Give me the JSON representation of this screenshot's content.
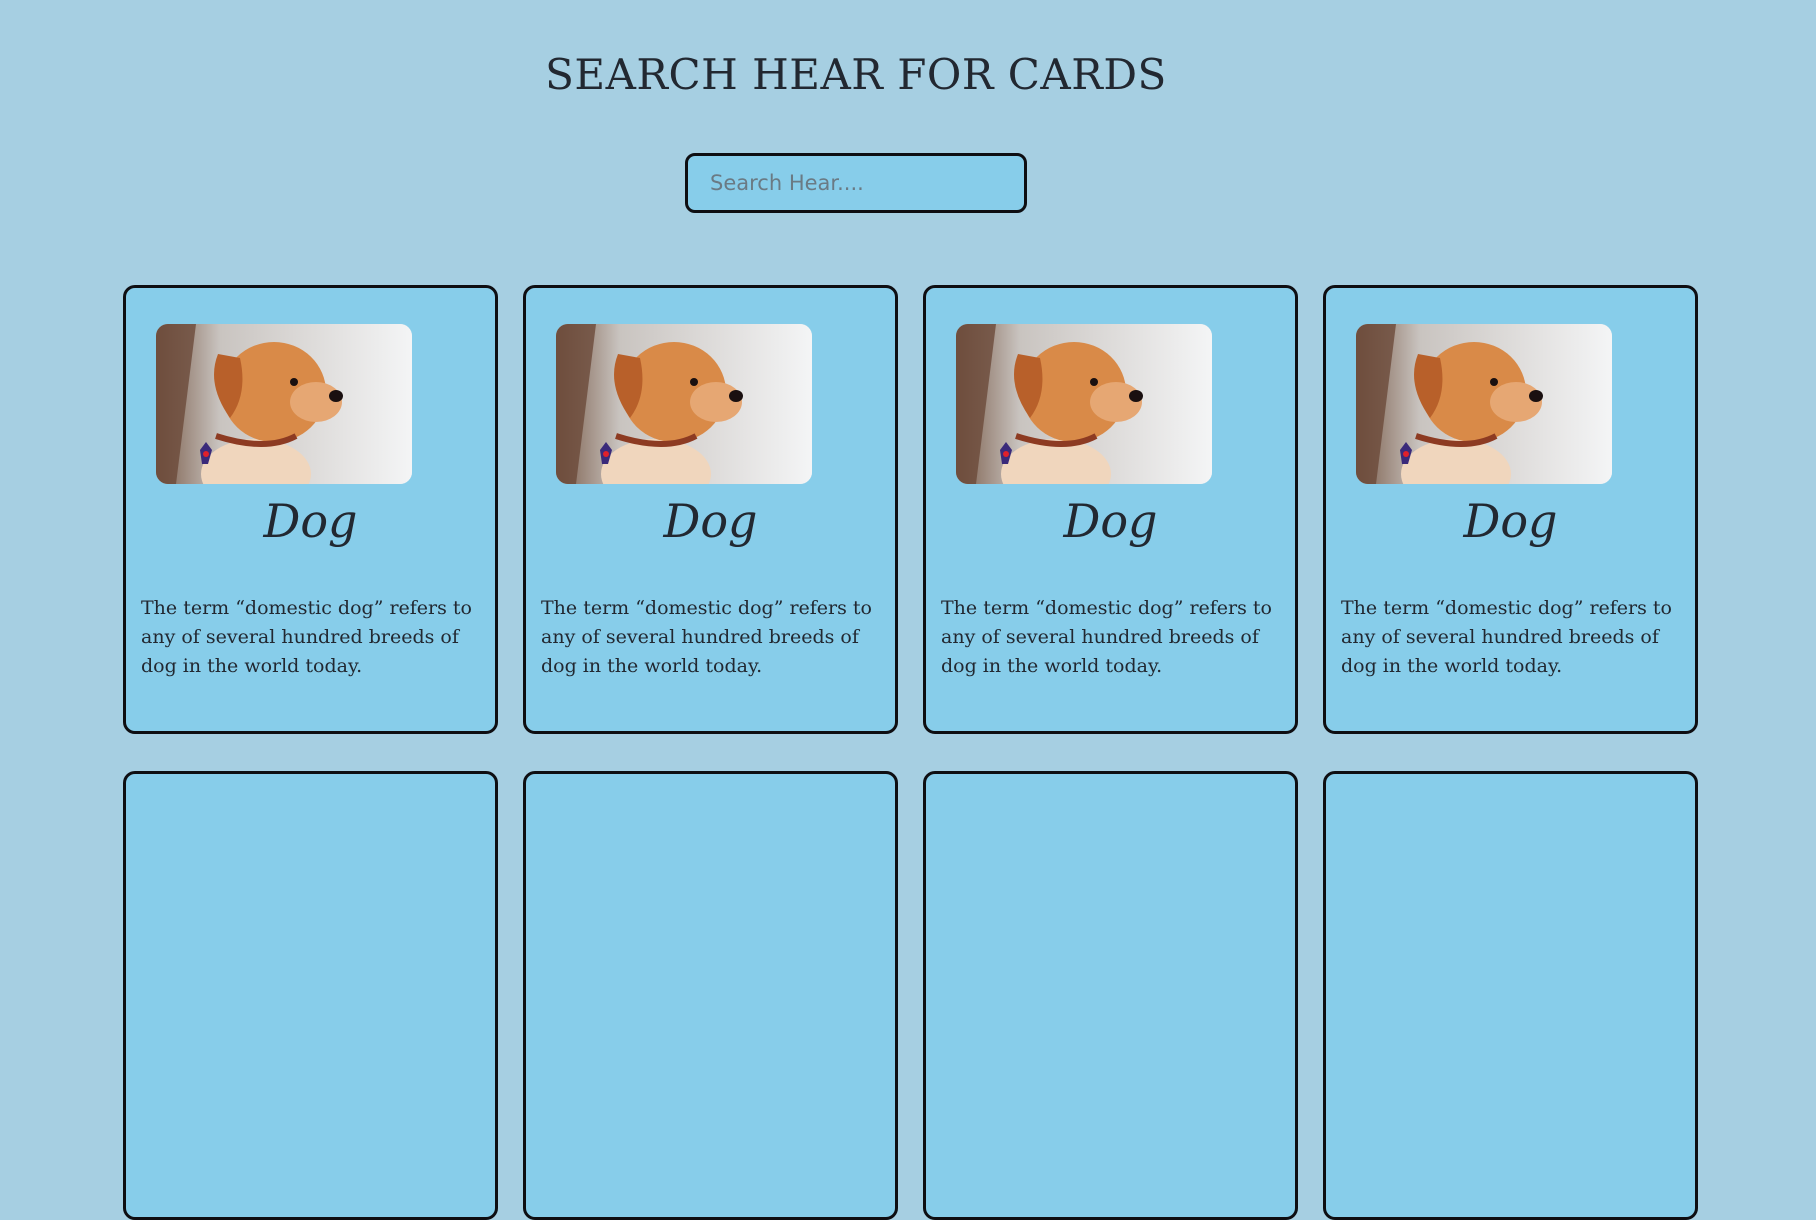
{
  "page": {
    "title": "SEARCH HEAR FOR CARDS",
    "search": {
      "placeholder": "Search Hear....",
      "value": ""
    }
  },
  "cards": [
    {
      "title": "Dog",
      "image_icon": "puppy-photo",
      "text": "The term “domestic dog” refers to any of several hundred breeds of dog in the world today."
    },
    {
      "title": "Dog",
      "image_icon": "puppy-photo",
      "text": "The term “domestic dog” refers to any of several hundred breeds of dog in the world today."
    },
    {
      "title": "Dog",
      "image_icon": "puppy-photo",
      "text": "The term “domestic dog” refers to any of several hundred breeds of dog in the world today."
    },
    {
      "title": "Dog",
      "image_icon": "puppy-photo",
      "text": "The term “domestic dog” refers to any of several hundred breeds of dog in the world today."
    }
  ],
  "colors": {
    "background": "#a6cfe2",
    "card": "#87cdea",
    "border": "#0e0e12",
    "text": "#222831"
  }
}
